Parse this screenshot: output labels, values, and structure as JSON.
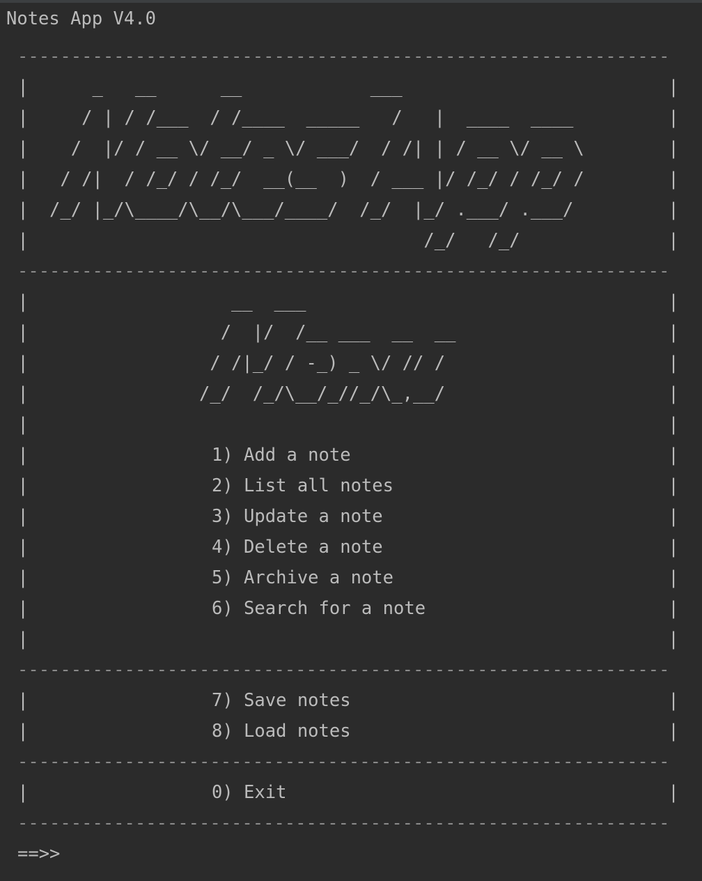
{
  "window": {
    "title": "Notes App V4.0"
  },
  "separator": "-------------------------------------------------------------",
  "border_char": "|",
  "banner": {
    "lines": [
      "       _   __      __            ___",
      "      / | / /___  / /____  _____   /   |  ____  ____",
      "     /  |/ / __ \\/ __/ _ \\/ ___/  / /| | / __ \\/ __ \\",
      "    / /|  / /_/ / /_/  __(__  )  / ___ |/ /_/ / /_/ /",
      "   /_/ |_/\\____/\\__/\\___/____/  /_/  |_/ .___/ .___/",
      "                                      /_/   /_/"
    ]
  },
  "menu_title": {
    "lines": [
      "                    __  ___",
      "                   /  |/  /__ ___  __  __",
      "                  / /|_/ / -_) _ \\/ // /",
      "                 /_/  /_/\\__/_//_/\\_,__/"
    ]
  },
  "menu": {
    "main_items": [
      "1) Add a note",
      "2) List all notes",
      "3) Update a note",
      "4) Delete a note",
      "5) Archive a note",
      "6) Search for a note"
    ],
    "file_items": [
      "7) Save notes",
      "8) Load notes"
    ],
    "exit_item": "0) Exit"
  },
  "prompt": {
    "text": "==>>"
  },
  "colors": {
    "background": "#2b2b2b",
    "text": "#bbbbbb",
    "top_border": "#3c3f41"
  }
}
